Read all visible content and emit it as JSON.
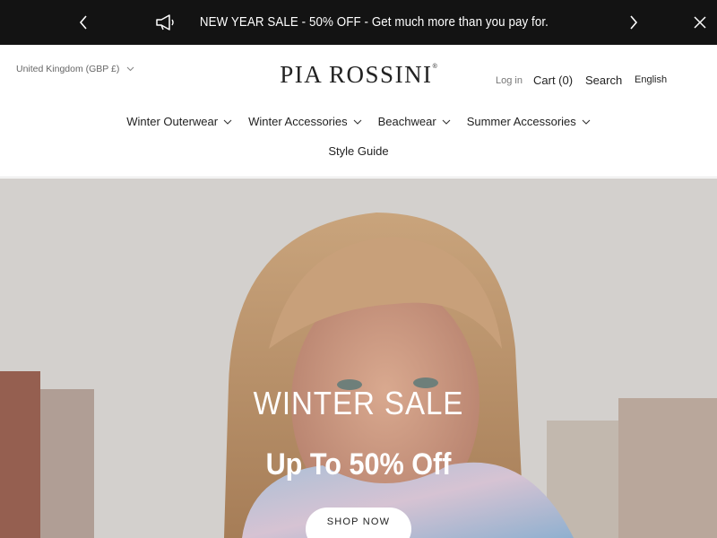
{
  "announcement": {
    "message": "NEW YEAR SALE - 50% OFF - Get much more than you pay for.",
    "icon": "megaphone-icon"
  },
  "header": {
    "country_selector": "United Kingdom (GBP £)",
    "logo_text": "PIA ROSSINI",
    "logo_mark": "®",
    "login": "Log in",
    "cart": "Cart (0)",
    "search": "Search",
    "language": "English"
  },
  "nav": {
    "items": [
      {
        "label": "Winter Outerwear"
      },
      {
        "label": "Winter Accessories"
      },
      {
        "label": "Beachwear"
      },
      {
        "label": "Summer Accessories"
      }
    ],
    "style_guide": "Style Guide"
  },
  "hero": {
    "title": "WINTER SALE",
    "subtitle": "Up To 50% Off",
    "button": "SHOP NOW"
  },
  "colors": {
    "announcement_bg": "#131313",
    "text": "#222222",
    "hero_text": "#ffffff"
  }
}
